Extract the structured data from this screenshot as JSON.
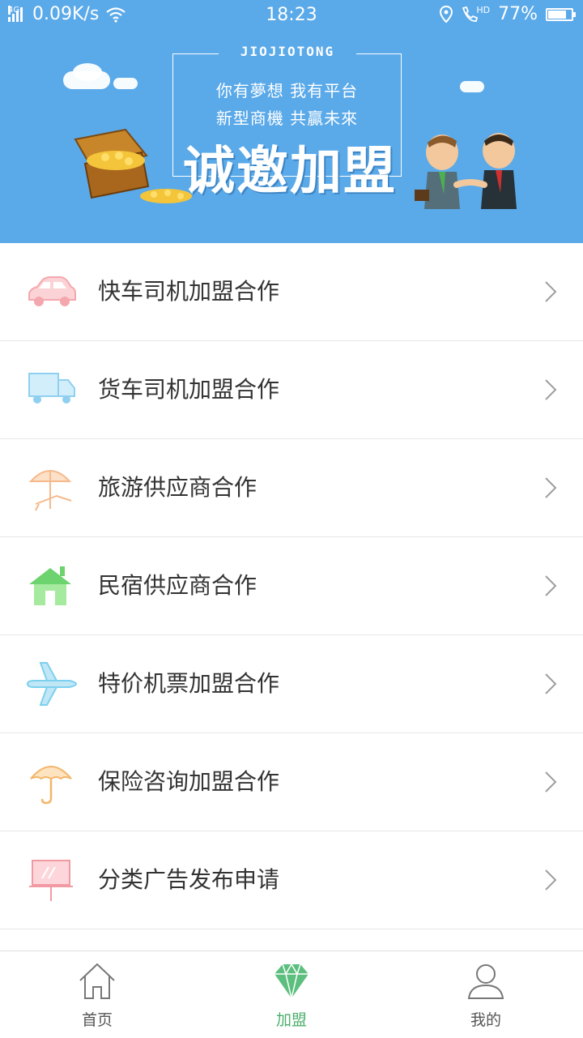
{
  "status_bar": {
    "network_type": "4G",
    "speed": "0.09K/s",
    "time": "18:23",
    "call_badge": "HD",
    "battery_percent": "77%",
    "battery_level": 0.77
  },
  "banner": {
    "brand": "JIOJIOTONG",
    "slogan_line1": "你有夢想  我有平台",
    "slogan_line2": "新型商機  共贏未來",
    "headline": "诚邀加盟",
    "background_color": "#5aa9e9"
  },
  "menu": {
    "items": [
      {
        "label": "快车司机加盟合作",
        "icon": "car-icon",
        "icon_color": "#f4a7ad"
      },
      {
        "label": "货车司机加盟合作",
        "icon": "truck-icon",
        "icon_color": "#8fd0f0"
      },
      {
        "label": "旅游供应商合作",
        "icon": "beach-umbrella-icon",
        "icon_color": "#f5b98b"
      },
      {
        "label": "民宿供应商合作",
        "icon": "house-icon",
        "icon_color": "#6cd36f"
      },
      {
        "label": "特价机票加盟合作",
        "icon": "airplane-icon",
        "icon_color": "#7dd0ee"
      },
      {
        "label": "保险咨询加盟合作",
        "icon": "umbrella-icon",
        "icon_color": "#f3b56a"
      },
      {
        "label": "分类广告发布申请",
        "icon": "billboard-icon",
        "icon_color": "#f29aa3"
      }
    ]
  },
  "tabbar": {
    "tabs": [
      {
        "label": "首页",
        "icon": "home-icon",
        "active": false
      },
      {
        "label": "加盟",
        "icon": "diamond-icon",
        "active": true
      },
      {
        "label": "我的",
        "icon": "user-icon",
        "active": false
      }
    ],
    "active_color": "#4caf6d"
  }
}
